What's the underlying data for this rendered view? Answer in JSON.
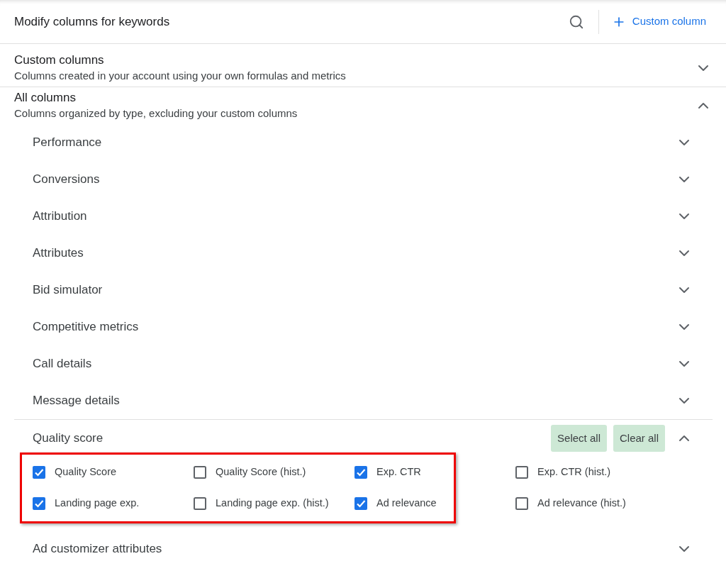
{
  "header": {
    "title": "Modify columns for keywords",
    "custom_column_button": "Custom column"
  },
  "sections": [
    {
      "title": "Custom columns",
      "subtitle": "Columns created in your account using your own formulas and metrics",
      "expanded": false
    },
    {
      "title": "All columns",
      "subtitle": "Columns organized by type, excluding your custom columns",
      "expanded": true,
      "categories": [
        {
          "name": "Performance",
          "expanded": false
        },
        {
          "name": "Conversions",
          "expanded": false
        },
        {
          "name": "Attribution",
          "expanded": false
        },
        {
          "name": "Attributes",
          "expanded": false
        },
        {
          "name": "Bid simulator",
          "expanded": false
        },
        {
          "name": "Competitive metrics",
          "expanded": false
        },
        {
          "name": "Call details",
          "expanded": false
        },
        {
          "name": "Message details",
          "expanded": false
        },
        {
          "name": "Quality score",
          "expanded": true,
          "actions": [
            "Select all",
            "Clear all"
          ],
          "columns": [
            {
              "label": "Quality Score",
              "checked": true
            },
            {
              "label": "Quality Score (hist.)",
              "checked": false
            },
            {
              "label": "Exp. CTR",
              "checked": true
            },
            {
              "label": "Exp. CTR (hist.)",
              "checked": false
            },
            {
              "label": "Landing page exp.",
              "checked": true
            },
            {
              "label": "Landing page exp. (hist.)",
              "checked": false
            },
            {
              "label": "Ad relevance",
              "checked": true
            },
            {
              "label": "Ad relevance (hist.)",
              "checked": false
            }
          ]
        },
        {
          "name": "Ad customizer attributes",
          "expanded": false
        }
      ]
    }
  ]
}
